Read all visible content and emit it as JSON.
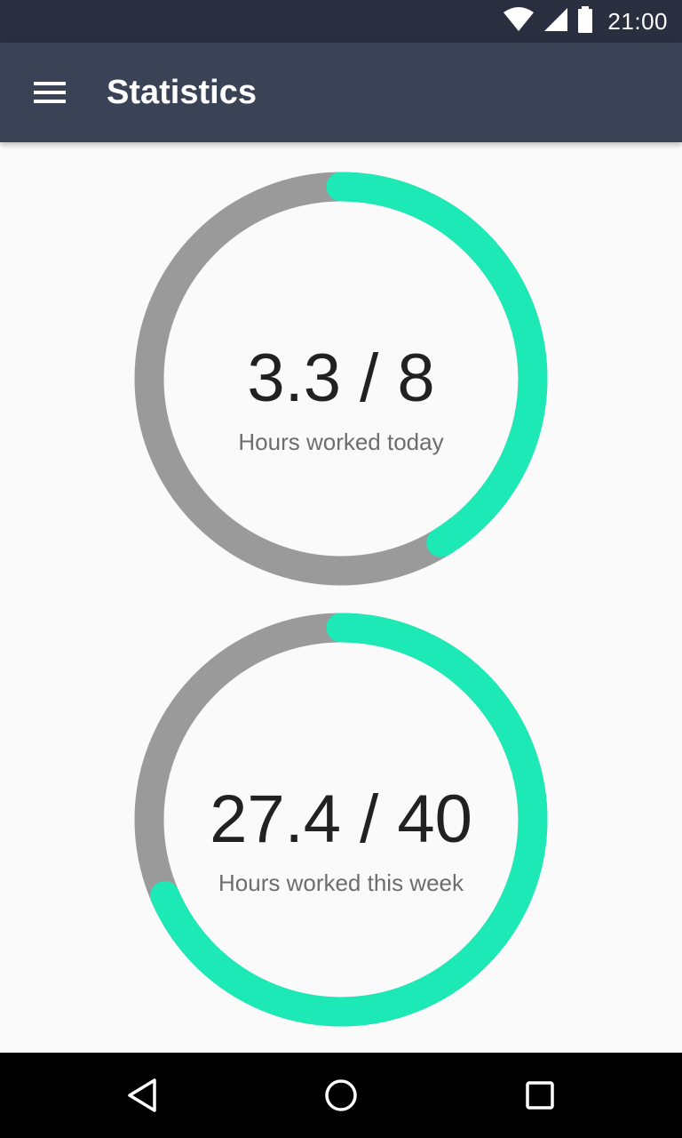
{
  "status_bar": {
    "time": "21:00",
    "icons": [
      "wifi-icon",
      "cell-signal-icon",
      "battery-icon"
    ]
  },
  "app_bar": {
    "title": "Statistics",
    "menu_icon": "hamburger-menu-icon"
  },
  "stats": [
    {
      "value_text": "3.3 / 8",
      "label": "Hours worked today",
      "progress": 0.4125
    },
    {
      "value_text": "27.4 / 40",
      "label": "Hours worked this week",
      "progress": 0.685
    }
  ],
  "colors": {
    "status_bar": "#2a2f3f",
    "app_bar": "#3a4256",
    "ring_track": "#9a9a9a",
    "ring_progress": "#1de9b6",
    "background": "#fafafa"
  },
  "nav_bar": {
    "buttons": [
      "back-icon",
      "home-icon",
      "recents-icon"
    ]
  }
}
